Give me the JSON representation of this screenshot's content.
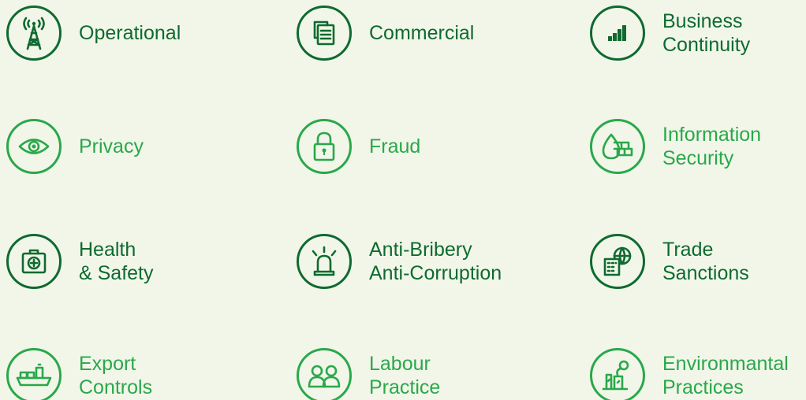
{
  "items": [
    {
      "lines": [
        "Operational",
        ""
      ],
      "icon": "radio-tower-icon"
    },
    {
      "lines": [
        "Commercial",
        ""
      ],
      "icon": "documents-icon"
    },
    {
      "lines": [
        "Business",
        "Continuity"
      ],
      "icon": "signal-bars-icon"
    },
    {
      "lines": [
        "Privacy",
        ""
      ],
      "icon": "eye-icon"
    },
    {
      "lines": [
        "Fraud",
        ""
      ],
      "icon": "padlock-icon"
    },
    {
      "lines": [
        "Information",
        "Security"
      ],
      "icon": "firewall-icon"
    },
    {
      "lines": [
        "Health",
        "& Safety"
      ],
      "icon": "first-aid-kit-icon"
    },
    {
      "lines": [
        "Anti-Bribery",
        "Anti-Corruption"
      ],
      "icon": "alarm-light-icon"
    },
    {
      "lines": [
        "Trade",
        "Sanctions"
      ],
      "icon": "globe-building-icon"
    },
    {
      "lines": [
        "Export",
        "Controls"
      ],
      "icon": "cargo-ship-icon"
    },
    {
      "lines": [
        "Labour",
        "Practice"
      ],
      "icon": "people-icon"
    },
    {
      "lines": [
        "Environmantal",
        "Practices"
      ],
      "icon": "factory-icon"
    }
  ],
  "colors": {
    "background": "#f1f6e9",
    "dark_green": "#0f6a2f",
    "light_green": "#2aa84a"
  }
}
